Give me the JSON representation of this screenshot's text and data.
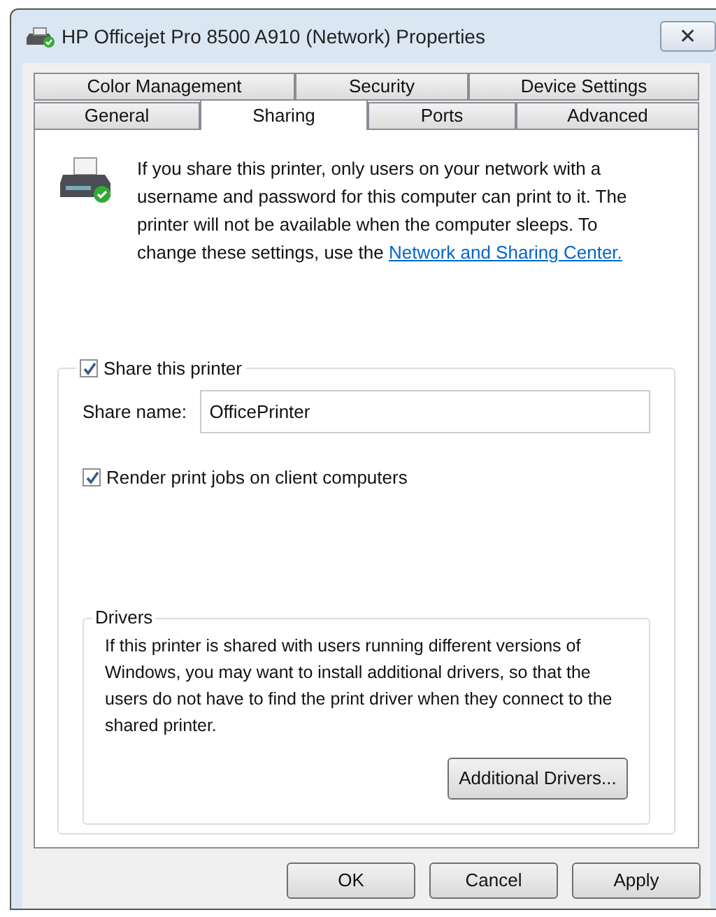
{
  "window": {
    "title": "HP Officejet Pro 8500 A910 (Network) Properties",
    "close": "✕"
  },
  "tab_rows": [
    [
      {
        "label": "Color Management",
        "selected": false
      },
      {
        "label": "Security",
        "selected": false
      },
      {
        "label": "Device Settings",
        "selected": false
      }
    ],
    [
      {
        "label": "General",
        "selected": false
      },
      {
        "label": "Sharing",
        "selected": true
      },
      {
        "label": "Ports",
        "selected": false
      },
      {
        "label": "Advanced",
        "selected": false
      }
    ]
  ],
  "intro": {
    "text": "If you share this printer, only users on your network with a username and password for this computer can print to it. The printer will not be available when the computer sleeps. To change these settings, use the ",
    "link": "Network and Sharing Center."
  },
  "share_printer": {
    "label": "Share this printer",
    "checked": true
  },
  "share_name": {
    "label": "Share name:",
    "value": "OfficePrinter"
  },
  "render_jobs": {
    "label": "Render print jobs on client computers",
    "checked": true
  },
  "drivers": {
    "title": "Drivers",
    "text": "If this printer is shared with users running different versions of Windows, you may want to install additional drivers, so that the users do not have to find the print driver when they connect to the shared printer.",
    "button": "Additional Drivers..."
  },
  "buttons": [
    "OK",
    "Cancel",
    "Apply"
  ]
}
